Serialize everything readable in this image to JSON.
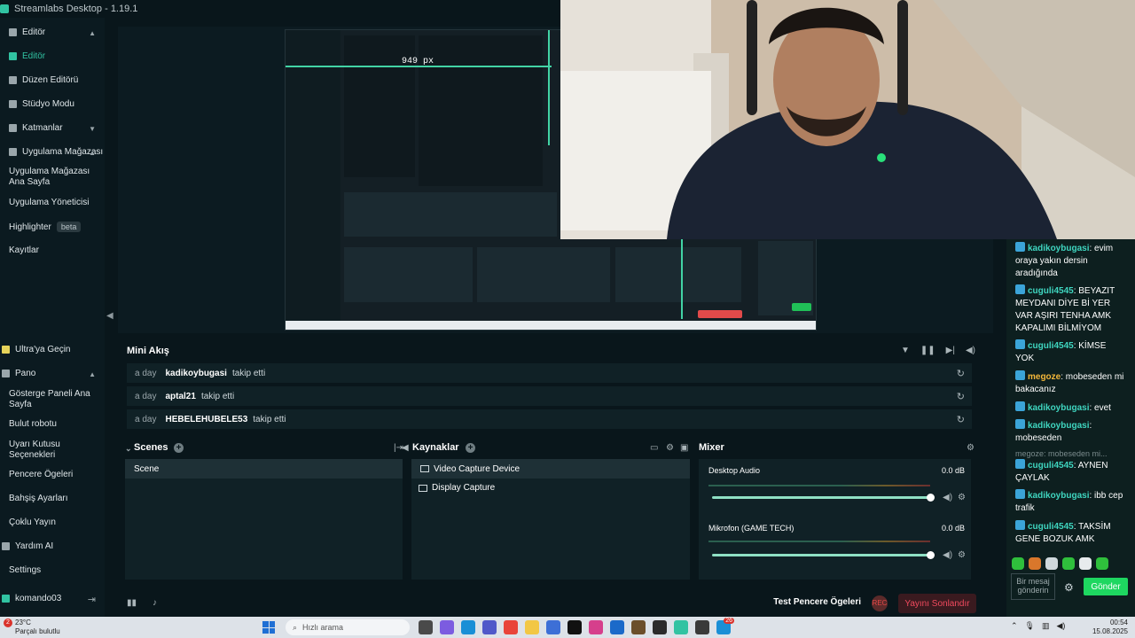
{
  "window": {
    "title": "Streamlabs Desktop - 1.19.1"
  },
  "sidebar": {
    "editor_section": "Editör",
    "items": [
      {
        "label": "Editör",
        "icon": "editor-icon"
      },
      {
        "label": "Düzen Editörü",
        "icon": "layout-icon"
      },
      {
        "label": "Stüdyo Modu",
        "icon": "studio-icon"
      }
    ],
    "layers": "Katmanlar",
    "app_store": "Uygulama Mağazası",
    "app_store_home": "Uygulama Mağazası Ana Sayfa",
    "app_manager": "Uygulama Yöneticisi",
    "highlighter": "Highlighter",
    "beta": "beta",
    "recordings": "Kayıtlar",
    "ultra": "Ultra'ya Geçin",
    "dashboard": "Pano",
    "dashboard_home": "Gösterge Paneli Ana Sayfa",
    "cloudbot": "Bulut robotu",
    "alert_box": "Uyarı Kutusu Seçenekleri",
    "widgets": "Pencere Ögeleri",
    "tipping": "Bahşiş Ayarları",
    "multistream": "Çoklu Yayın",
    "help": "Yardım AI",
    "settings": "Settings",
    "user": "komando03"
  },
  "preview": {
    "measure_label": "949 px"
  },
  "mini_feed": {
    "title": "Mini Akış",
    "rows": [
      {
        "when": "a day",
        "who": "kadikoybugasi",
        "action": "takip etti"
      },
      {
        "when": "a day",
        "who": "aptal21",
        "action": "takip etti"
      },
      {
        "when": "a day",
        "who": "HEBELEHUBELE53",
        "action": "takip etti"
      }
    ]
  },
  "scenes": {
    "title": "Scenes",
    "items": [
      "Scene"
    ]
  },
  "sources": {
    "title": "Kaynaklar",
    "items": [
      "Video Capture Device",
      "Display Capture"
    ]
  },
  "mixer": {
    "title": "Mixer",
    "channels": [
      {
        "name": "Desktop Audio",
        "db": "0.0 dB",
        "volume": 1.0
      },
      {
        "name": "Mikrofon (GAME TECH)",
        "db": "0.0 dB",
        "volume": 1.0
      }
    ]
  },
  "footer": {
    "test_widgets": "Test Pencere Ögeleri",
    "end_stream": "Yayını Sonlandır"
  },
  "chat": {
    "messages": [
      {
        "user": "kadikoybugasi",
        "text": ": evim oraya yakın dersin aradığında",
        "color": "teal"
      },
      {
        "user": "cuguli4545",
        "text": ": BEYAZIT MEYDANI DİYE Bİ YER VAR AŞIRI TENHA AMK KAPALIMI BİLMİYOM",
        "color": "teal"
      },
      {
        "user": "cuguli4545",
        "text": ": KİMSE YOK",
        "color": "teal"
      },
      {
        "user": "megoze",
        "text": ": mobeseden mi bakacanız",
        "color": "gold"
      },
      {
        "user": "kadikoybugasi",
        "text": ": evet",
        "color": "teal"
      },
      {
        "user": "kadikoybugasi",
        "text": ": mobeseden",
        "color": "teal"
      },
      {
        "user": "",
        "text": "megoze: mobeseden mi...",
        "color": "faded"
      },
      {
        "user": "cuguli4545",
        "text": ": AYNEN ÇAYLAK",
        "color": "teal"
      },
      {
        "user": "kadikoybugasi",
        "text": ": ibb cep trafik",
        "color": "teal"
      },
      {
        "user": "cuguli4545",
        "text": ": TAKSİM GENE BOZUK AMK",
        "color": "teal"
      }
    ],
    "input_placeholder": "Bir mesaj gönderin",
    "send_label": "Gönder"
  },
  "taskbar": {
    "temperature": "23°C",
    "weather": "Parçalı bulutlu",
    "weather_badge": "2",
    "search_placeholder": "Hızlı arama",
    "time": "00:54",
    "date": "15.08.2025",
    "notification_count": "26"
  }
}
